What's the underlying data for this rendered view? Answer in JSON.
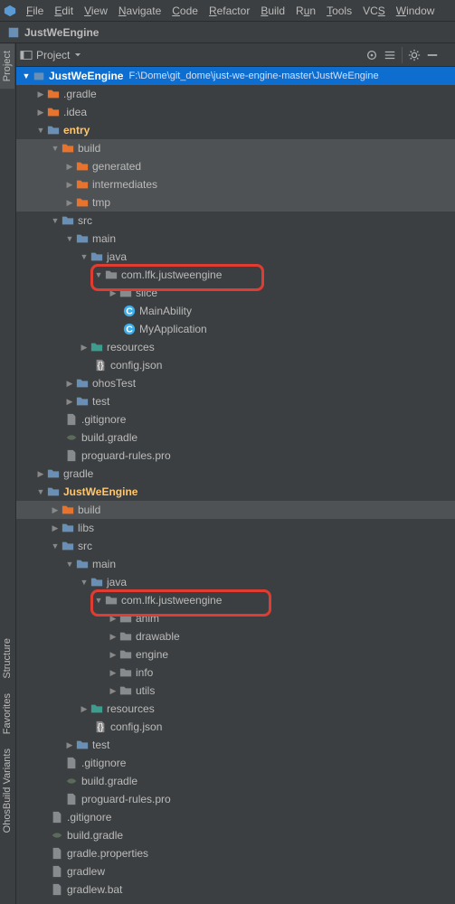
{
  "menu": {
    "file": "File",
    "edit": "Edit",
    "view": "View",
    "navigate": "Navigate",
    "code": "Code",
    "refactor": "Refactor",
    "build": "Build",
    "run": "Run",
    "tools": "Tools",
    "vcs": "VCS",
    "window": "Window"
  },
  "breadcrumb": {
    "project": "JustWeEngine"
  },
  "toolbar": {
    "view": "Project"
  },
  "tree": {
    "root": {
      "label": "JustWeEngine",
      "path": "F:\\Dome\\git_dome\\just-we-engine-master\\JustWeEngine"
    },
    "gradle_dir": ".gradle",
    "idea_dir": ".idea",
    "entry": "entry",
    "build": "build",
    "generated": "generated",
    "intermediates": "intermediates",
    "tmp": "tmp",
    "src": "src",
    "main": "main",
    "java": "java",
    "pkg": "com.lfk.justweengine",
    "slice": "slice",
    "main_ability": "MainAbility",
    "my_application": "MyApplication",
    "resources": "resources",
    "config_json": "config.json",
    "ohos_test": "ohosTest",
    "test": "test",
    "gitignore": ".gitignore",
    "build_gradle": "build.gradle",
    "proguard": "proguard-rules.pro",
    "gradle": "gradle",
    "jwe": "JustWeEngine",
    "libs": "libs",
    "anim": "anim",
    "drawable": "drawable",
    "engine": "engine",
    "info": "info",
    "utils": "utils",
    "gradle_props": "gradle.properties",
    "gradlew": "gradlew",
    "gradlew_bat": "gradlew.bat"
  }
}
